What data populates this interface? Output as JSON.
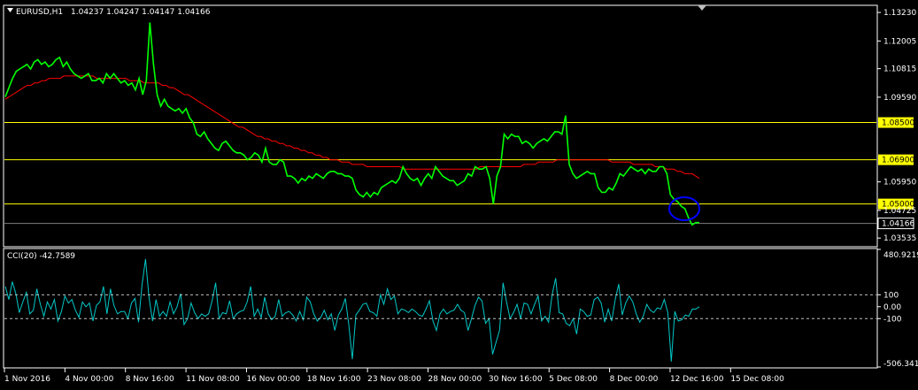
{
  "symbol_header": {
    "symbol": "EURUSD,H1",
    "ohlc": "1.04237 1.04247 1.04147 1.04166"
  },
  "colors": {
    "background": "#000000",
    "price_line": "#00ff00",
    "moving_average": "#ff0000",
    "level_line": "#ffff00",
    "level_label_bg": "#ffff00",
    "cci_line": "#00c8c8",
    "circle": "#0000ff",
    "axis": "#ffffff"
  },
  "chart_data": [
    {
      "type": "line",
      "pane": "main",
      "ylim": [
        1.032,
        1.135
      ],
      "price_ticks": [
        "1.13230",
        "1.12005",
        "1.10815",
        "1.09590",
        "1.05950",
        "1.04725",
        "1.03535"
      ],
      "current_price": "1.04166",
      "levels": [
        {
          "label": "1.08500",
          "value": 1.085
        },
        {
          "label": "1.06900",
          "value": 1.069
        },
        {
          "label": "1.05000",
          "value": 1.05
        }
      ],
      "series": [
        {
          "values": [
            1.096,
            1.1,
            1.104,
            1.107,
            1.108,
            1.109,
            1.11,
            1.108,
            1.111,
            1.112,
            1.11,
            1.111,
            1.109,
            1.11,
            1.112,
            1.113,
            1.109,
            1.111,
            1.108,
            1.106,
            1.105,
            1.104,
            1.105,
            1.106,
            1.103,
            1.103,
            1.104,
            1.102,
            1.106,
            1.104,
            1.106,
            1.104,
            1.102,
            1.103,
            1.101,
            1.102,
            1.099,
            1.104,
            1.097,
            1.103,
            1.128,
            1.11,
            1.097,
            1.092,
            1.095,
            1.092,
            1.091,
            1.09,
            1.091,
            1.089,
            1.091,
            1.087,
            1.085,
            1.08,
            1.079,
            1.081,
            1.078,
            1.076,
            1.074,
            1.073,
            1.076,
            1.077,
            1.075,
            1.073,
            1.072,
            1.072,
            1.071,
            1.069,
            1.07,
            1.072,
            1.071,
            1.068,
            1.074,
            1.068,
            1.067,
            1.067,
            1.069,
            1.068,
            1.062,
            1.062,
            1.061,
            1.059,
            1.061,
            1.06,
            1.062,
            1.061,
            1.063,
            1.062,
            1.061,
            1.063,
            1.064,
            1.064,
            1.063,
            1.063,
            1.062,
            1.062,
            1.061,
            1.056,
            1.054,
            1.053,
            1.055,
            1.053,
            1.055,
            1.054,
            1.057,
            1.058,
            1.059,
            1.06,
            1.059,
            1.061,
            1.066,
            1.063,
            1.061,
            1.06,
            1.061,
            1.058,
            1.061,
            1.063,
            1.061,
            1.066,
            1.064,
            1.062,
            1.061,
            1.06,
            1.06,
            1.058,
            1.059,
            1.06,
            1.063,
            1.062,
            1.066,
            1.065,
            1.065,
            1.066,
            1.061,
            1.05,
            1.062,
            1.066,
            1.08,
            1.078,
            1.08,
            1.079,
            1.079,
            1.076,
            1.077,
            1.076,
            1.074,
            1.076,
            1.077,
            1.078,
            1.077,
            1.079,
            1.081,
            1.081,
            1.08,
            1.088,
            1.067,
            1.063,
            1.061,
            1.062,
            1.063,
            1.064,
            1.063,
            1.063,
            1.057,
            1.055,
            1.055,
            1.057,
            1.056,
            1.059,
            1.063,
            1.062,
            1.064,
            1.066,
            1.065,
            1.064,
            1.065,
            1.063,
            1.065,
            1.064,
            1.064,
            1.066,
            1.066,
            1.063,
            1.054,
            1.052,
            1.051,
            1.049,
            1.048,
            1.044,
            1.041,
            1.042,
            1.042
          ]
        },
        {
          "values": [
            1.095,
            1.096,
            1.097,
            1.098,
            1.099,
            1.1,
            1.101,
            1.101,
            1.102,
            1.102,
            1.103,
            1.103,
            1.104,
            1.104,
            1.104,
            1.104,
            1.105,
            1.105,
            1.105,
            1.105,
            1.105,
            1.105,
            1.105,
            1.105,
            1.105,
            1.104,
            1.104,
            1.104,
            1.104,
            1.104,
            1.104,
            1.104,
            1.104,
            1.104,
            1.103,
            1.103,
            1.103,
            1.103,
            1.102,
            1.102,
            1.102,
            1.102,
            1.102,
            1.101,
            1.101,
            1.1,
            1.1,
            1.099,
            1.098,
            1.097,
            1.097,
            1.096,
            1.095,
            1.094,
            1.093,
            1.092,
            1.091,
            1.09,
            1.089,
            1.088,
            1.087,
            1.086,
            1.085,
            1.084,
            1.083,
            1.083,
            1.082,
            1.081,
            1.08,
            1.079,
            1.079,
            1.078,
            1.078,
            1.077,
            1.077,
            1.076,
            1.076,
            1.075,
            1.075,
            1.074,
            1.074,
            1.073,
            1.073,
            1.072,
            1.072,
            1.071,
            1.071,
            1.07,
            1.07,
            1.069,
            1.069,
            1.069,
            1.068,
            1.068,
            1.068,
            1.067,
            1.067,
            1.067,
            1.067,
            1.066,
            1.066,
            1.066,
            1.066,
            1.066,
            1.066,
            1.066,
            1.066,
            1.066,
            1.066,
            1.065,
            1.065,
            1.065,
            1.065,
            1.065,
            1.065,
            1.065,
            1.065,
            1.065,
            1.065,
            1.065,
            1.065,
            1.065,
            1.065,
            1.065,
            1.065,
            1.065,
            1.065,
            1.065,
            1.065,
            1.065,
            1.066,
            1.066,
            1.066,
            1.066,
            1.066,
            1.066,
            1.066,
            1.066,
            1.066,
            1.066,
            1.066,
            1.066,
            1.067,
            1.067,
            1.067,
            1.067,
            1.068,
            1.068,
            1.068,
            1.068,
            1.068,
            1.069,
            1.069,
            1.069,
            1.069,
            1.069,
            1.069,
            1.069,
            1.069,
            1.069,
            1.069,
            1.069,
            1.069,
            1.069,
            1.069,
            1.069,
            1.068,
            1.068,
            1.068,
            1.068,
            1.068,
            1.068,
            1.067,
            1.067,
            1.067,
            1.067,
            1.067,
            1.067,
            1.066,
            1.066,
            1.066,
            1.065,
            1.065,
            1.065,
            1.064,
            1.064,
            1.063,
            1.063,
            1.063,
            1.062,
            1.061
          ]
        }
      ]
    },
    {
      "type": "line",
      "pane": "indicator",
      "indicator_label": "CCI(20) -42.7589",
      "ylim": [
        -506.3411,
        480.9219
      ],
      "ticks": [
        {
          "label": "480.9219",
          "value": 480.9219
        },
        {
          "label": "100",
          "value": 100
        },
        {
          "label": "0.00",
          "value": 0
        },
        {
          "label": "-100",
          "value": -100
        },
        {
          "label": "-506.341",
          "value": -506.3411
        }
      ],
      "series": [
        {
          "values": [
            170,
            60,
            210,
            110,
            -50,
            40,
            120,
            -60,
            -30,
            150,
            20,
            -80,
            40,
            -20,
            60,
            -120,
            -40,
            90,
            30,
            60,
            -30,
            -90,
            40,
            0,
            30,
            -120,
            10,
            40,
            170,
            -60,
            150,
            10,
            -60,
            -40,
            -40,
            -100,
            30,
            70,
            -130,
            180,
            400,
            80,
            -120,
            60,
            -80,
            -40,
            -80,
            40,
            -60,
            0,
            110,
            -150,
            -100,
            30,
            -50,
            -100,
            -60,
            -80,
            -60,
            50,
            200,
            -100,
            -50,
            -60,
            50,
            -100,
            -60,
            -40,
            -30,
            40,
            170,
            -80,
            -20,
            -90,
            80,
            -60,
            -110,
            -80,
            60,
            -80,
            -50,
            -40,
            -70,
            -120,
            -40,
            -110,
            80,
            40,
            -60,
            -120,
            -90,
            -30,
            -110,
            -60,
            -200,
            -70,
            -20,
            70,
            -150,
            -440,
            -70,
            -30,
            20,
            30,
            -40,
            -50,
            -80,
            100,
            20,
            150,
            60,
            90,
            -60,
            -20,
            -30,
            -50,
            -20,
            -40,
            -70,
            -80,
            -20,
            50,
            -120,
            -200,
            -60,
            -20,
            -60,
            -40,
            -30,
            20,
            -30,
            -50,
            -200,
            -100,
            10,
            80,
            50,
            -140,
            -100,
            -400,
            -300,
            -200,
            200,
            40,
            -100,
            -50,
            20,
            -100,
            30,
            20,
            -60,
            20,
            90,
            -120,
            -80,
            -130,
            100,
            240,
            -50,
            -60,
            -140,
            -160,
            -100,
            -230,
            -20,
            -40,
            -80,
            -70,
            60,
            80,
            30,
            -130,
            -20,
            -120,
            60,
            190,
            -70,
            30,
            90,
            40,
            -60,
            -130,
            -80,
            20,
            -30,
            -50,
            -10,
            -20,
            60,
            -50,
            -460,
            -40,
            -120,
            -110,
            -70,
            -80,
            -20,
            -20,
            0
          ]
        }
      ]
    }
  ],
  "time_labels": [
    "1 Nov 2016",
    "4 Nov 00:00",
    "8 Nov 16:00",
    "11 Nov 08:00",
    "16 Nov 00:00",
    "18 Nov 16:00",
    "23 Nov 08:00",
    "28 Nov 00:00",
    "30 Nov 16:00",
    "5 Dec 08:00",
    "8 Dec 00:00",
    "12 Dec 16:00",
    "15 Dec 08:00"
  ]
}
